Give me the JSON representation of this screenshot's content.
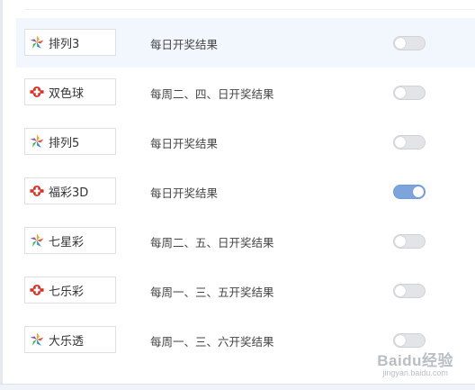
{
  "lotteries": [
    {
      "name": "排列3",
      "schedule": "每日开奖结果",
      "icon": "star-pinwheel-icon",
      "enabled": false
    },
    {
      "name": "双色球",
      "schedule": "每周二、四、日开奖结果",
      "icon": "welfare-lottery-icon",
      "enabled": false
    },
    {
      "name": "排列5",
      "schedule": "每日开奖结果",
      "icon": "star-pinwheel-icon",
      "enabled": false
    },
    {
      "name": "福彩3D",
      "schedule": "每日开奖结果",
      "icon": "welfare-lottery-icon",
      "enabled": true
    },
    {
      "name": "七星彩",
      "schedule": "每周二、五、日开奖结果",
      "icon": "star-pinwheel-icon",
      "enabled": false
    },
    {
      "name": "七乐彩",
      "schedule": "每周一、三、五开奖结果",
      "icon": "welfare-lottery-icon",
      "enabled": false
    },
    {
      "name": "大乐透",
      "schedule": "每周一、三、六开奖结果",
      "icon": "star-pinwheel-icon",
      "enabled": false
    }
  ],
  "colors": {
    "toggle_on": "#7ca5de",
    "toggle_off": "#e2e4e7",
    "row_highlight": "#f1f7fd",
    "welfare_red": "#e02b20"
  },
  "watermark": {
    "main": "Baidu经验",
    "sub": "jingyan.baidu.com"
  }
}
